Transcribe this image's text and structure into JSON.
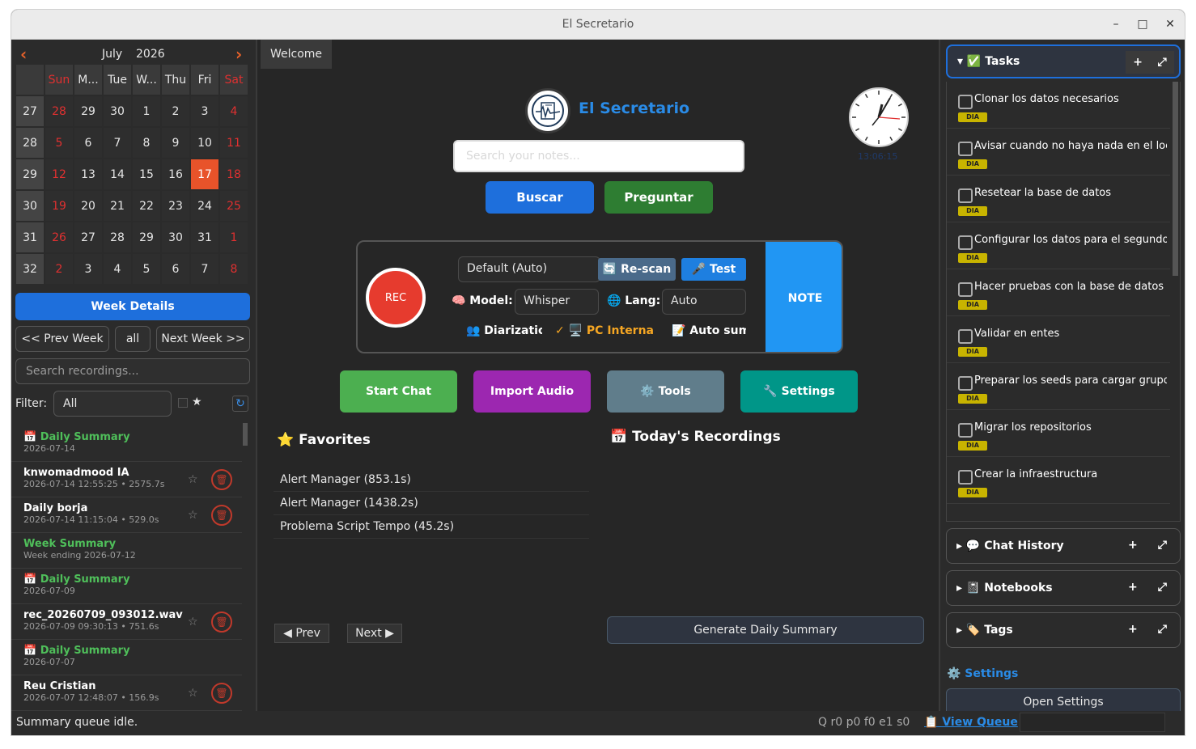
{
  "window": {
    "title": "El Secretario"
  },
  "calendar": {
    "month": "July",
    "year": "2026",
    "headers": [
      "",
      "Sun",
      "M...",
      "Tue",
      "W...",
      "Thu",
      "Fri",
      "Sat"
    ],
    "weeks": [
      {
        "wk": "27",
        "days": [
          "28",
          "29",
          "30",
          "1",
          "2",
          "3",
          "4"
        ]
      },
      {
        "wk": "28",
        "days": [
          "5",
          "6",
          "7",
          "8",
          "9",
          "10",
          "11"
        ]
      },
      {
        "wk": "29",
        "days": [
          "12",
          "13",
          "14",
          "15",
          "16",
          "17",
          "18"
        ]
      },
      {
        "wk": "30",
        "days": [
          "19",
          "20",
          "21",
          "22",
          "23",
          "24",
          "25"
        ]
      },
      {
        "wk": "31",
        "days": [
          "26",
          "27",
          "28",
          "29",
          "30",
          "31",
          "1"
        ]
      },
      {
        "wk": "32",
        "days": [
          "2",
          "3",
          "4",
          "5",
          "6",
          "7",
          "8"
        ]
      }
    ],
    "today": "17",
    "today_color": "#e8532a"
  },
  "left": {
    "week_details": "Week Details",
    "prev_week": "<< Prev Week",
    "all": "all",
    "next_week": "Next Week >>",
    "search_placeholder": "Search recordings...",
    "filter_label": "Filter:",
    "filter_value": "All",
    "fav_star": "★",
    "recordings": [
      {
        "title": "📅 Daily Summary",
        "sub": "2026-07-14",
        "summary": true
      },
      {
        "title": "knwomadmood IA",
        "sub": "2026-07-14 12:55:25 • 2575.7s",
        "summary": false
      },
      {
        "title": "Daily borja",
        "sub": "2026-07-14 11:15:04 • 529.0s",
        "summary": false
      },
      {
        "title": "Week Summary",
        "sub": "Week ending 2026-07-12",
        "summary": true
      },
      {
        "title": "📅 Daily Summary",
        "sub": "2026-07-09",
        "summary": true
      },
      {
        "title": "rec_20260709_093012.wav",
        "sub": "2026-07-09 09:30:13 • 751.6s",
        "summary": false
      },
      {
        "title": "📅 Daily Summary",
        "sub": "2026-07-07",
        "summary": true
      },
      {
        "title": "Reu Cristian",
        "sub": "2026-07-07 12:48:07 • 156.9s",
        "summary": false
      }
    ]
  },
  "center": {
    "tab": "Welcome",
    "brand": "El Secretario",
    "clock_time": "13:06:15",
    "search_placeholder": "Search your notes...",
    "buscar": "Buscar",
    "preguntar": "Preguntar",
    "rec": "REC",
    "device": "Default (Auto)",
    "rescan": "🔄 Re-scan",
    "test": "🎤 Test",
    "model_label": "🧠 Model:",
    "model_value": "Whisper",
    "lang_label": "🌐 Lang:",
    "lang_value": "Auto",
    "diarization": "👥 Diarizatior",
    "pc_interna": "✓ 🖥️ PC Interna",
    "auto_summary": "📝 Auto sumr",
    "note": "NOTE",
    "start_chat": "Start Chat",
    "import_audio": "Import Audio",
    "tools": "⚙️ Tools",
    "settings": "🔧 Settings",
    "favorites_title": "⭐ Favorites",
    "todays_title": "📅 Today's Recordings",
    "favorites": [
      "Alert Manager (853.1s)",
      "Alert Manager (1438.2s)",
      "Problema Script Tempo (45.2s)"
    ],
    "prev": "◀ Prev",
    "next": "Next ▶",
    "generate": "Generate Daily Summary"
  },
  "right": {
    "tasks_label": "▾ ✅ Tasks",
    "tasks": [
      "Clonar los datos necesarios",
      "Avisar cuando no haya nada en el local",
      "Resetear la base de datos",
      "Configurar los datos para el segundo se",
      "Hacer pruebas con la base de datos",
      "Validar en entes",
      "Preparar los seeds para cargar grupos d",
      "Migrar los repositorios",
      "Crear la infraestructura"
    ],
    "task_tag": "DIA",
    "chat_history": "▸ 💬 Chat History",
    "notebooks": "▸ 📓 Notebooks",
    "tags": "▸ 🏷️ Tags",
    "settings_head": "⚙️ Settings",
    "open_settings": "Open Settings",
    "plus": "+",
    "expand": "⤢"
  },
  "status": {
    "text": "Summary queue idle.",
    "queue": "Q r0 p0 f0 e1 s0",
    "view_queue": "📋 View Queue"
  }
}
